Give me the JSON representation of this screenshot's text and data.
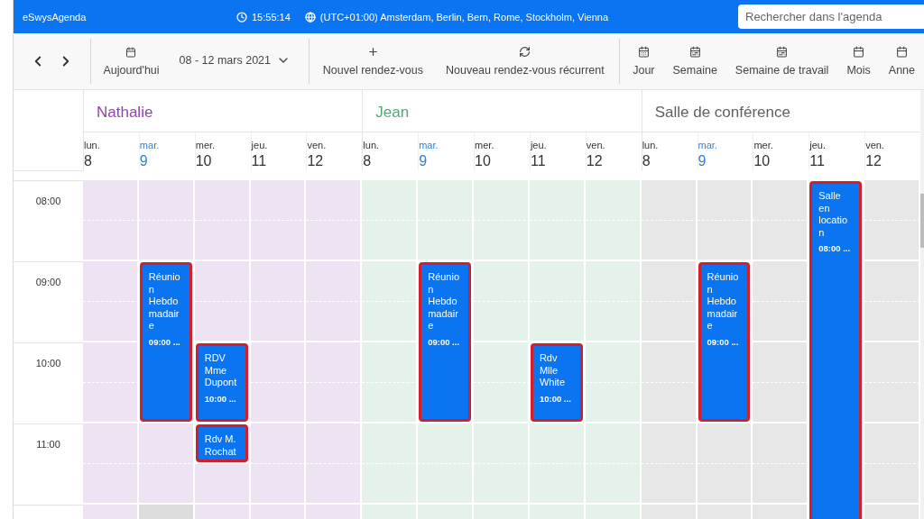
{
  "app": {
    "title": "eSwysAgenda",
    "clock": "15:55:14",
    "timezone": "(UTC+01:00) Amsterdam, Berlin, Bern, Rome, Stockholm, Vienna",
    "search": {
      "placeholder": "Rechercher dans l'agenda"
    }
  },
  "toolbar": {
    "today": "Aujourd'hui",
    "date_range": "08 - 12 mars 2021",
    "actions": [
      {
        "label": "Nouvel rendez-vous",
        "kind": "plus"
      },
      {
        "label": "Nouveau rendez-vous récurrent",
        "kind": "repeat"
      }
    ],
    "views": [
      {
        "label": "Jour",
        "kind": "day"
      },
      {
        "label": "Semaine",
        "kind": "week"
      },
      {
        "label": "Semaine de travail",
        "kind": "week"
      },
      {
        "label": "Mois",
        "kind": "month"
      },
      {
        "label": "Anne",
        "kind": "month"
      }
    ]
  },
  "hours": [
    "08:00",
    "09:00",
    "10:00",
    "11:00"
  ],
  "resources": [
    {
      "name": "Nathalie",
      "color": "#8e44ad",
      "days": [
        {
          "weekday": "lun.",
          "date": "8",
          "today": false,
          "slots": [
            {
              "kind": "free"
            },
            {
              "kind": "free"
            },
            {
              "kind": "free"
            },
            {
              "kind": "free"
            },
            {
              "kind": "free"
            },
            {
              "kind": "free"
            },
            {
              "kind": "free"
            },
            {
              "kind": "free"
            },
            {
              "kind": "free"
            }
          ]
        },
        {
          "weekday": "mar.",
          "date": "9",
          "today": true,
          "slots": [
            {
              "kind": "free"
            },
            {
              "kind": "free"
            },
            {
              "kind": "event",
              "title": "Réunion Hebdomadaire",
              "time": "09:00 ..."
            },
            {
              "kind": "more"
            },
            {
              "kind": "more"
            },
            {
              "kind": "more"
            },
            {
              "kind": "free"
            },
            {
              "kind": "free"
            },
            {
              "kind": "blocked"
            }
          ]
        },
        {
          "weekday": "mer.",
          "date": "10",
          "today": false,
          "slots": [
            {
              "kind": "free"
            },
            {
              "kind": "free"
            },
            {
              "kind": "free"
            },
            {
              "kind": "free"
            },
            {
              "kind": "event",
              "title": "RDV Mme Dupont",
              "time": "10:00 ..."
            },
            {
              "kind": "more"
            },
            {
              "kind": "event",
              "title": "Rdv M. Rochat"
            },
            {
              "kind": "free"
            },
            {
              "kind": "free"
            }
          ]
        },
        {
          "weekday": "jeu.",
          "date": "11",
          "today": false,
          "slots": [
            {
              "kind": "free"
            },
            {
              "kind": "free"
            },
            {
              "kind": "free"
            },
            {
              "kind": "free"
            },
            {
              "kind": "free"
            },
            {
              "kind": "free"
            },
            {
              "kind": "free"
            },
            {
              "kind": "free"
            },
            {
              "kind": "free"
            }
          ]
        },
        {
          "weekday": "ven.",
          "date": "12",
          "today": false,
          "slots": [
            {
              "kind": "free"
            },
            {
              "kind": "free"
            },
            {
              "kind": "free"
            },
            {
              "kind": "free"
            },
            {
              "kind": "free"
            },
            {
              "kind": "free"
            },
            {
              "kind": "free"
            },
            {
              "kind": "free"
            },
            {
              "kind": "free"
            }
          ]
        }
      ]
    },
    {
      "name": "Jean",
      "color": "#4caa72",
      "days": [
        {
          "weekday": "lun.",
          "date": "8",
          "today": false,
          "slots": [
            {
              "kind": "free"
            },
            {
              "kind": "free"
            },
            {
              "kind": "free"
            },
            {
              "kind": "free"
            },
            {
              "kind": "free"
            },
            {
              "kind": "free"
            },
            {
              "kind": "free"
            },
            {
              "kind": "free"
            },
            {
              "kind": "free"
            }
          ]
        },
        {
          "weekday": "mar.",
          "date": "9",
          "today": true,
          "slots": [
            {
              "kind": "free"
            },
            {
              "kind": "free"
            },
            {
              "kind": "event",
              "title": "Réunion Hebdomadaire",
              "time": "09:00 ..."
            },
            {
              "kind": "more"
            },
            {
              "kind": "more"
            },
            {
              "kind": "more"
            },
            {
              "kind": "free"
            },
            {
              "kind": "free"
            },
            {
              "kind": "free"
            }
          ]
        },
        {
          "weekday": "mer.",
          "date": "10",
          "today": false,
          "slots": [
            {
              "kind": "free"
            },
            {
              "kind": "free"
            },
            {
              "kind": "free"
            },
            {
              "kind": "free"
            },
            {
              "kind": "free"
            },
            {
              "kind": "free"
            },
            {
              "kind": "free"
            },
            {
              "kind": "free"
            },
            {
              "kind": "free"
            }
          ]
        },
        {
          "weekday": "jeu.",
          "date": "11",
          "today": false,
          "slots": [
            {
              "kind": "free"
            },
            {
              "kind": "free"
            },
            {
              "kind": "free"
            },
            {
              "kind": "free"
            },
            {
              "kind": "event",
              "title": "Rdv Mlle White",
              "time": "10:00 ..."
            },
            {
              "kind": "more"
            },
            {
              "kind": "free"
            },
            {
              "kind": "free"
            },
            {
              "kind": "free"
            }
          ]
        },
        {
          "weekday": "ven.",
          "date": "12",
          "today": false,
          "slots": [
            {
              "kind": "free"
            },
            {
              "kind": "free"
            },
            {
              "kind": "free"
            },
            {
              "kind": "free"
            },
            {
              "kind": "free"
            },
            {
              "kind": "free"
            },
            {
              "kind": "free"
            },
            {
              "kind": "free"
            },
            {
              "kind": "free"
            }
          ]
        }
      ]
    },
    {
      "name": "Salle de conférence",
      "color": "#616161",
      "days": [
        {
          "weekday": "lun.",
          "date": "8",
          "today": false,
          "slots": [
            {
              "kind": "free"
            },
            {
              "kind": "free"
            },
            {
              "kind": "free"
            },
            {
              "kind": "free"
            },
            {
              "kind": "free"
            },
            {
              "kind": "free"
            },
            {
              "kind": "free"
            },
            {
              "kind": "free"
            },
            {
              "kind": "free"
            }
          ]
        },
        {
          "weekday": "mar.",
          "date": "9",
          "today": true,
          "slots": [
            {
              "kind": "free"
            },
            {
              "kind": "free"
            },
            {
              "kind": "event",
              "title": "Réunion Hebdomadaire",
              "time": "09:00 ..."
            },
            {
              "kind": "more"
            },
            {
              "kind": "more"
            },
            {
              "kind": "more"
            },
            {
              "kind": "free"
            },
            {
              "kind": "free"
            },
            {
              "kind": "free"
            }
          ]
        },
        {
          "weekday": "mer.",
          "date": "10",
          "today": false,
          "slots": [
            {
              "kind": "free"
            },
            {
              "kind": "free"
            },
            {
              "kind": "free"
            },
            {
              "kind": "free"
            },
            {
              "kind": "free"
            },
            {
              "kind": "free"
            },
            {
              "kind": "free"
            },
            {
              "kind": "free"
            },
            {
              "kind": "free"
            }
          ]
        },
        {
          "weekday": "jeu.",
          "date": "11",
          "today": false,
          "slots": [
            {
              "kind": "event",
              "title": "Salle en location",
              "time": "08:00 ..."
            },
            {
              "kind": "more"
            },
            {
              "kind": "more"
            },
            {
              "kind": "more"
            },
            {
              "kind": "more"
            },
            {
              "kind": "more"
            },
            {
              "kind": "more"
            },
            {
              "kind": "more"
            },
            {
              "kind": "more"
            }
          ]
        },
        {
          "weekday": "ven.",
          "date": "12",
          "today": false,
          "slots": [
            {
              "kind": "free"
            },
            {
              "kind": "free"
            },
            {
              "kind": "free"
            },
            {
              "kind": "free"
            },
            {
              "kind": "free"
            },
            {
              "kind": "free"
            },
            {
              "kind": "free"
            },
            {
              "kind": "free"
            },
            {
              "kind": "free"
            }
          ]
        }
      ]
    }
  ]
}
